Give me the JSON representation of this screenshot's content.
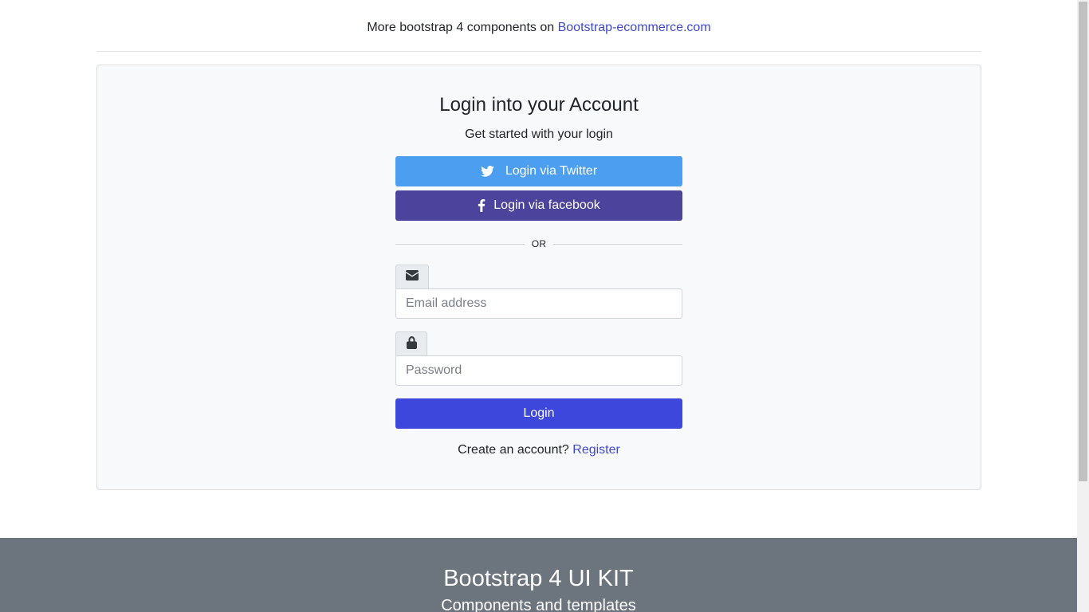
{
  "top_note": {
    "text": "More bootstrap 4 components on",
    "link_label": "Bootstrap-ecommerce.com"
  },
  "login_card": {
    "title": "Login into your Account",
    "subtitle": "Get started with your login",
    "twitter_button": {
      "label": "Login via Twitter",
      "icon": "twitter-icon"
    },
    "facebook_button": {
      "label": "Login via facebook",
      "icon": "facebook-icon"
    },
    "divider_text": "OR",
    "email": {
      "icon": "envelope-icon",
      "placeholder": "Email address",
      "value": ""
    },
    "password": {
      "icon": "lock-icon",
      "placeholder": "Password",
      "value": ""
    },
    "login_button": {
      "label": "Login"
    },
    "register": {
      "prompt": "Create an account?",
      "link_label": "Register"
    }
  },
  "footer": {
    "title": "Bootstrap 4 UI KIT",
    "subtitle": "Components and templates"
  },
  "colors": {
    "twitter": "#4c9ff0",
    "facebook": "#4c439d",
    "primary": "#3d47db",
    "link": "#3f48cc",
    "footer_bg": "#6c757d"
  }
}
